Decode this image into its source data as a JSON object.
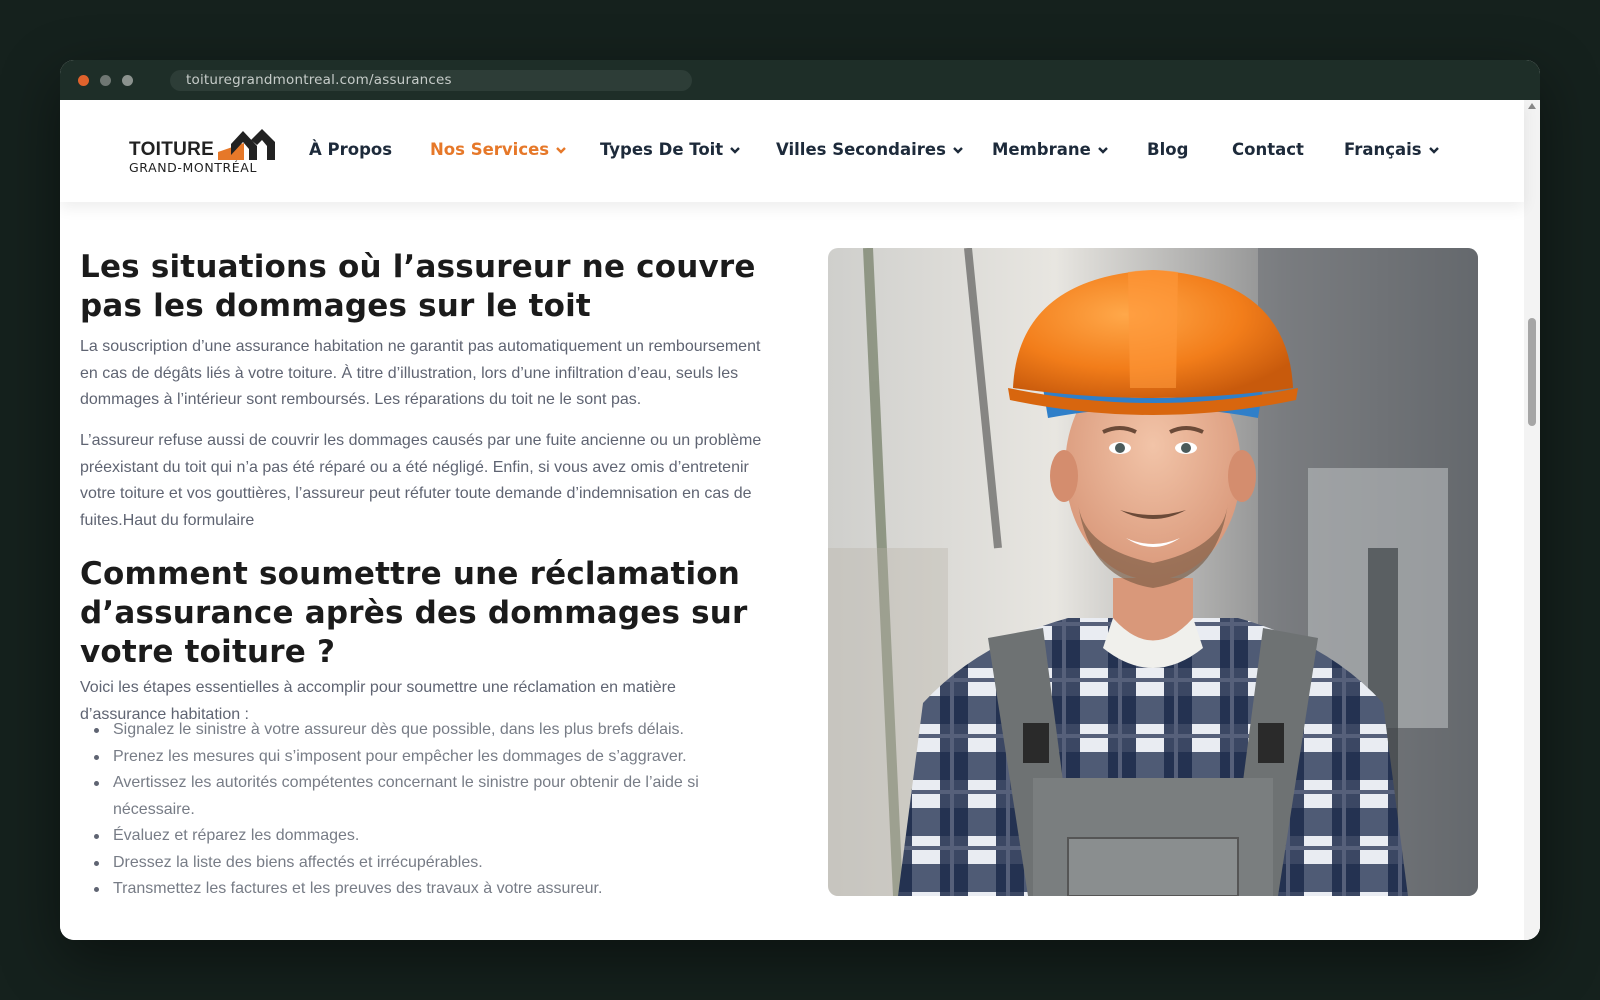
{
  "browser": {
    "url": "toituregrandmontreal.com/assurances"
  },
  "logo": {
    "wordmark": "TOITURE",
    "subtitle": "GRAND-MONTRÉAL",
    "accent_color": "#e67829"
  },
  "nav": {
    "items": [
      {
        "label": "À Propos",
        "has_dropdown": false
      },
      {
        "label": "Nos Services",
        "has_dropdown": true,
        "active": true
      },
      {
        "label": "Types De Toit",
        "has_dropdown": true
      },
      {
        "label": "Villes Secondaires",
        "has_dropdown": true
      },
      {
        "label": "Membrane",
        "has_dropdown": true
      },
      {
        "label": "Blog",
        "has_dropdown": false
      },
      {
        "label": "Contact",
        "has_dropdown": false
      },
      {
        "label": "Français",
        "has_dropdown": true
      }
    ],
    "active_color": "#e67829",
    "text_color": "#1d2a3a"
  },
  "article": {
    "section1_title": "Les situations où l’assureur ne couvre pas les dommages sur le toit",
    "section1_paragraphs": [
      "La souscription d’une assurance habitation ne garantit pas automatiquement un remboursement en cas de dégâts liés à votre toiture. À titre d’illustration, lors d’une infiltration d’eau, seuls les dommages à l’intérieur sont remboursés. Les réparations du toit ne le sont pas.",
      "L’assureur refuse aussi de couvrir les dommages causés par une fuite ancienne ou un problème préexistant du toit qui n’a pas été réparé ou a été négligé. Enfin, si vous avez omis d’entretenir votre toiture et vos gouttières, l’assureur peut réfuter toute demande d’indemnisation en cas de fuites.Haut du formulaire"
    ],
    "section2_title": "Comment soumettre une réclamation d’assurance après des dommages sur votre toiture ?",
    "section2_intro": "Voici les étapes essentielles à accomplir pour soumettre une réclamation en matière d’assurance habitation :",
    "steps": [
      "Signalez le sinistre à votre assureur dès que possible, dans les plus brefs délais.",
      "Prenez les mesures qui s’imposent pour empêcher les dommages de s’aggraver.",
      "Avertissez les autorités compétentes concernant le sinistre pour obtenir de l’aide si nécessaire.",
      "Évaluez et réparez les dommages.",
      "Dressez la liste des biens affectés et irrécupérables.",
      "Transmettez les factures et les preuves des travaux à votre assureur."
    ]
  },
  "photo": {
    "subject": "roofing worker in orange hard hat and plaid shirt with overalls"
  },
  "colors": {
    "page_background": "#15211d",
    "titlebar": "#1e2e28",
    "heading": "#1b1b1b",
    "body_text": "#5f6472"
  }
}
